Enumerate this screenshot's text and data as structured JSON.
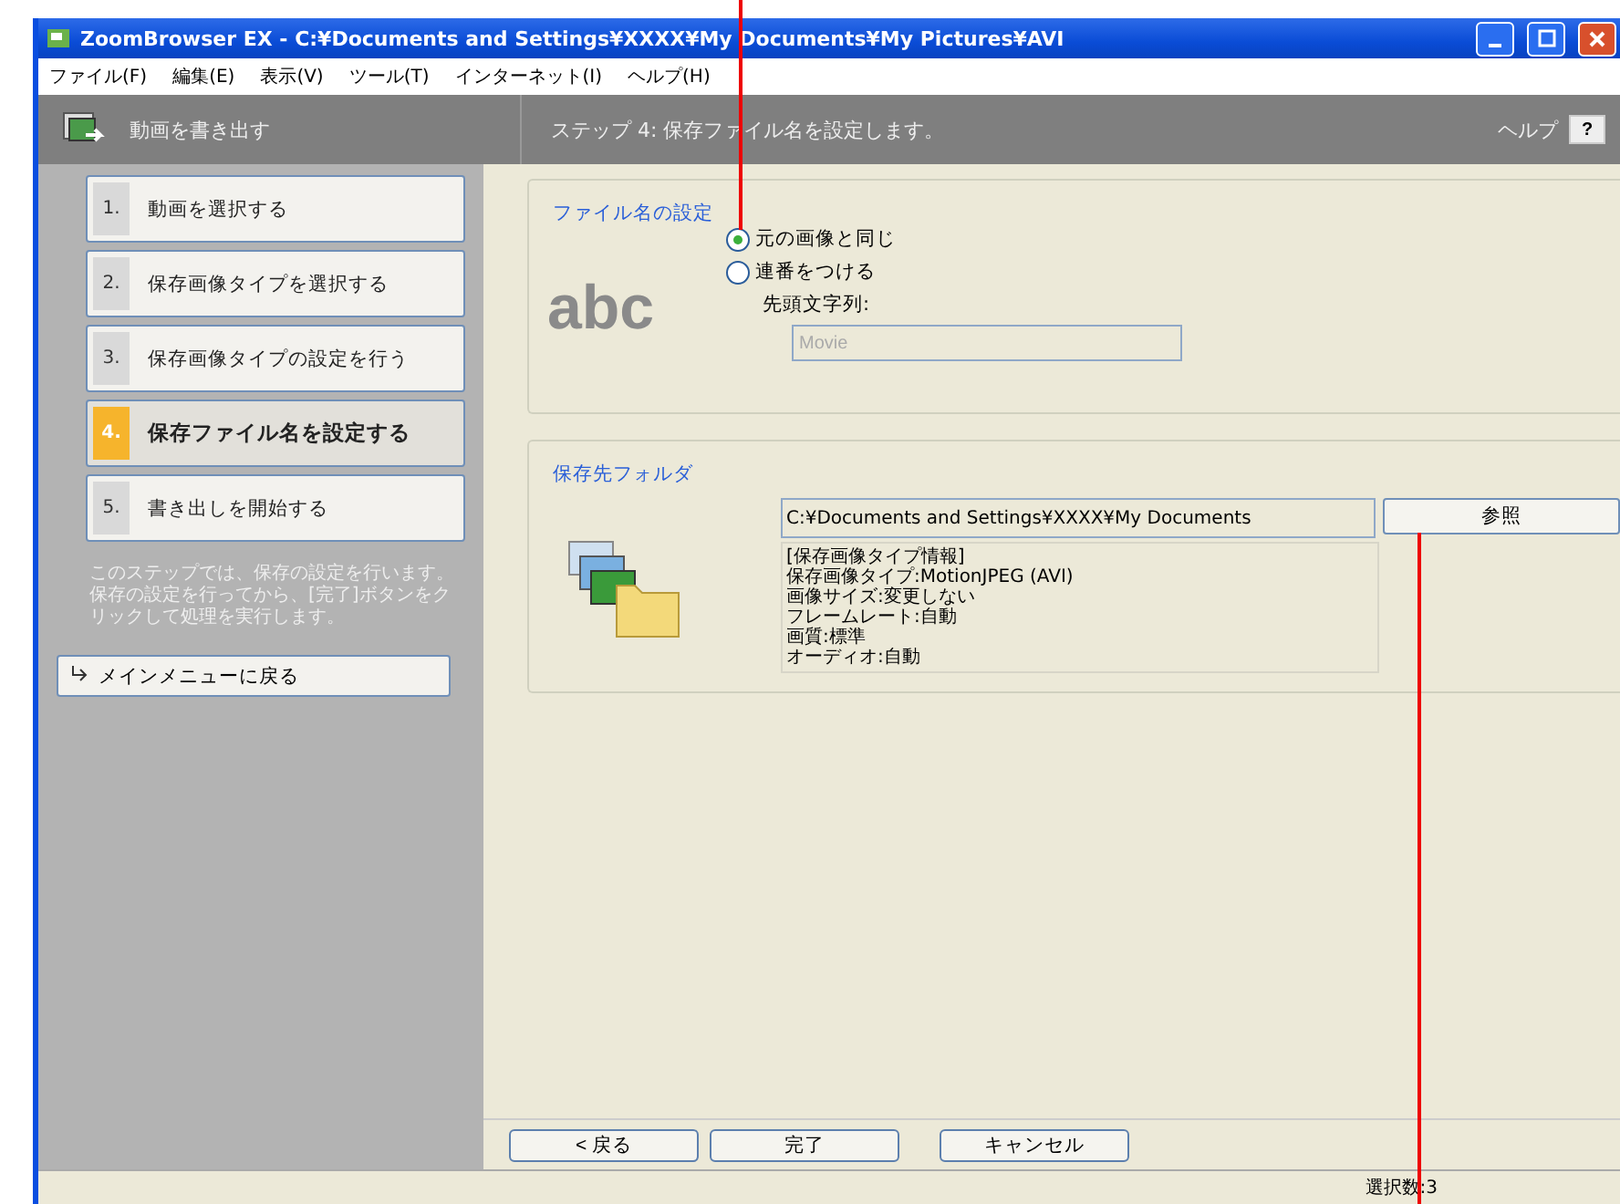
{
  "window": {
    "title": "ZoomBrowser EX  -  C:¥Documents and Settings¥XXXX¥My Documents¥My Pictures¥AVI"
  },
  "menu": [
    "ファイル(F)",
    "編集(E)",
    "表示(V)",
    "ツール(T)",
    "インターネット(I)",
    "ヘルプ(H)"
  ],
  "header": {
    "task": "動画を書き出す",
    "step_title": "ステップ 4:  保存ファイル名を設定します。",
    "help": "ヘルプ",
    "help_button": "?"
  },
  "steps": [
    {
      "number": "1.",
      "label": "動画を選択する",
      "selected": false
    },
    {
      "number": "2.",
      "label": "保存画像タイプを選択する",
      "selected": false
    },
    {
      "number": "3.",
      "label": "保存画像タイプの設定を行う",
      "selected": false
    },
    {
      "number": "4.",
      "label": "保存ファイル名を設定する",
      "selected": true
    },
    {
      "number": "5.",
      "label": "書き出しを開始する",
      "selected": false
    }
  ],
  "description": "このステップでは、保存の設定を行います。保存の設定を行ってから、[完了]ボタンをクリックして処理を実行します。",
  "main_menu_button": "メインメニューに戻る",
  "file_name_group": {
    "title": "ファイル名の設定",
    "sample": "abc",
    "options": [
      {
        "label": "元の画像と同じ",
        "selected": true
      },
      {
        "label": "連番をつける",
        "selected": false
      }
    ],
    "prefix_label": "先頭文字列:",
    "prefix_value": "Movie",
    "prefix_disabled": true
  },
  "folder_group": {
    "title": "保存先フォルダ",
    "path": "C:¥Documents and Settings¥XXXX¥My Documents",
    "browse_button": "参照",
    "info": [
      "[保存画像タイプ情報]",
      "保存画像タイプ:MotionJPEG (AVI)",
      "画像サイズ:変更しない",
      "フレームレート:自動",
      "画質:標準",
      "オーディオ:自動"
    ]
  },
  "buttons": [
    "< 戻る",
    "完了",
    "キャンセル"
  ],
  "status_bar": "選択数:3"
}
